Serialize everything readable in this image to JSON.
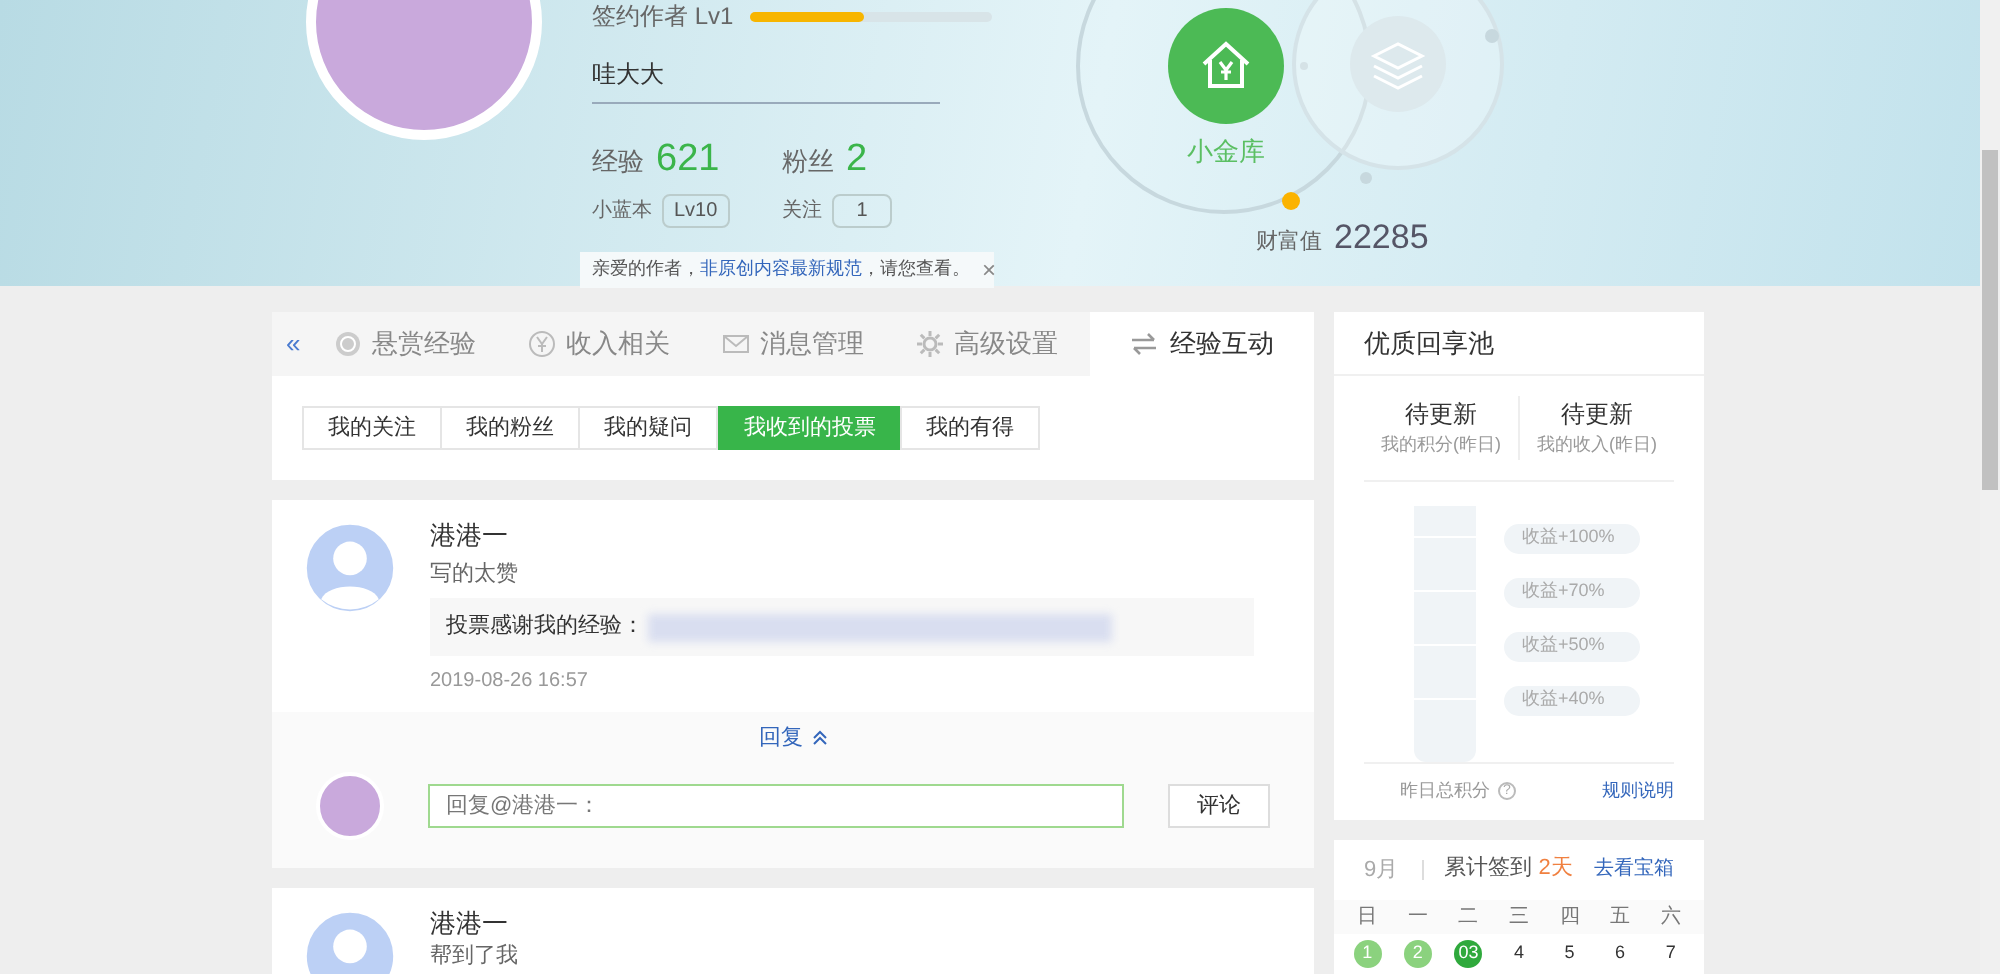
{
  "profile": {
    "rank_label": "签约作者 Lv1",
    "level": 0.47,
    "name": "哇大大",
    "stats": [
      {
        "label": "经验",
        "value": "621"
      },
      {
        "label": "粉丝",
        "value": "2"
      }
    ],
    "badges": [
      {
        "label": "小蓝本",
        "value": "Lv10"
      },
      {
        "label": "关注",
        "value": "1"
      }
    ],
    "notice": {
      "before": "亲爱的作者，",
      "link": "非原创内容最新规范",
      "after": "，请您查看。",
      "close": "×"
    }
  },
  "vault": {
    "label": "小金库",
    "wealth_label": "财富值",
    "wealth": "22285"
  },
  "collapse": "«",
  "tabs": [
    {
      "label": "悬赏经验",
      "kind": "coin",
      "selected": false
    },
    {
      "label": "收入相关",
      "kind": "yen",
      "selected": false
    },
    {
      "label": "消息管理",
      "kind": "mail",
      "selected": false
    },
    {
      "label": "高级设置",
      "kind": "gear",
      "selected": false
    },
    {
      "label": "经验互动",
      "kind": "swap",
      "selected": true
    }
  ],
  "subtabs": [
    {
      "label": "我的关注",
      "selected": false
    },
    {
      "label": "我的粉丝",
      "selected": false
    },
    {
      "label": "我的疑问",
      "selected": false
    },
    {
      "label": "我收到的投票",
      "selected": true
    },
    {
      "label": "我的有得",
      "selected": false
    }
  ],
  "votes": [
    {
      "user": "港港一",
      "comment": "写的太赞",
      "thanks": "投票感谢我的经验：",
      "time": "2019-08-26 16:57",
      "reply_toggle": "回复",
      "reply_placeholder": "回复@港港一：",
      "submit": "评论",
      "expanded": true
    },
    {
      "user": "港港一",
      "comment": "帮到了我",
      "expanded": false
    }
  ],
  "pool": {
    "title": "优质回享池",
    "metrics": [
      {
        "value": "待更新",
        "label": "我的积分(昨日)"
      },
      {
        "value": "待更新",
        "label": "我的收入(昨日)"
      }
    ],
    "tiers": [
      "收益+100%",
      "收益+70%",
      "收益+50%",
      "收益+40%"
    ],
    "total_label": "昨日总积分",
    "help": "?",
    "rules": "规则说明"
  },
  "signin": {
    "month": "9月",
    "count_label": "累计签到",
    "count": "2天",
    "link": "去看宝箱",
    "weekdays": [
      "日",
      "一",
      "二",
      "三",
      "四",
      "五",
      "六"
    ],
    "days": [
      {
        "label": "1",
        "kind": "signed"
      },
      {
        "label": "2",
        "kind": "signed"
      },
      {
        "label": "03",
        "kind": "today"
      },
      {
        "label": "4",
        "kind": "plain"
      },
      {
        "label": "5",
        "kind": "plain"
      },
      {
        "label": "6",
        "kind": "plain"
      },
      {
        "label": "7",
        "kind": "plain"
      }
    ]
  }
}
